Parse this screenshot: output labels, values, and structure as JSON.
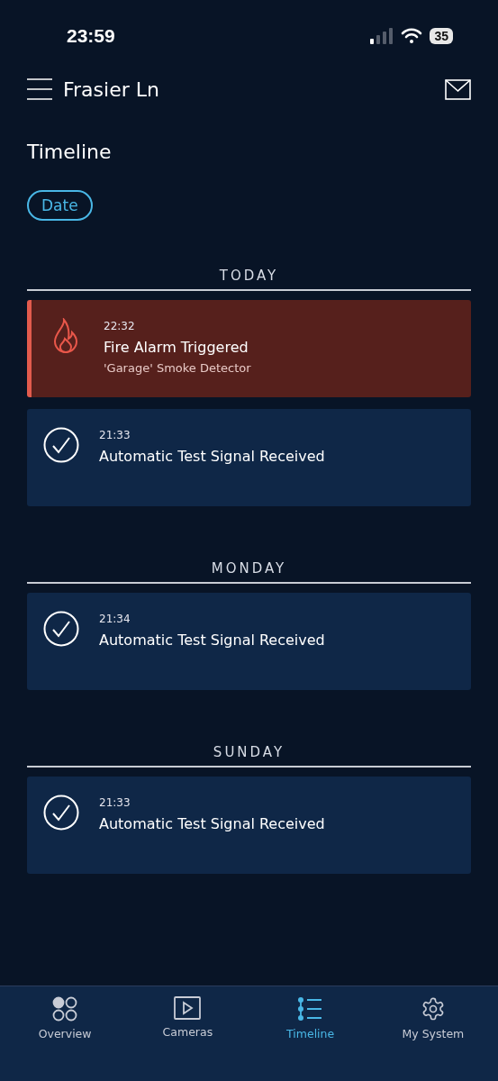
{
  "status_bar": {
    "time": "23:59",
    "battery": "35"
  },
  "header": {
    "title": "Frasier Ln"
  },
  "page_title": "Timeline",
  "filter": {
    "label": "Date"
  },
  "sections": [
    {
      "heading": "TODAY",
      "events": [
        {
          "kind": "alarm",
          "time": "22:32",
          "title": "Fire Alarm Triggered",
          "detail": "'Garage' Smoke Detector"
        },
        {
          "kind": "check",
          "time": "21:33",
          "title": "Automatic Test Signal Received"
        }
      ]
    },
    {
      "heading": "MONDAY",
      "events": [
        {
          "kind": "check",
          "time": "21:34",
          "title": "Automatic Test Signal Received"
        }
      ]
    },
    {
      "heading": "SUNDAY",
      "events": [
        {
          "kind": "check",
          "time": "21:33",
          "title": "Automatic Test Signal Received"
        }
      ]
    }
  ],
  "tab_bar": [
    {
      "kind": "overview",
      "label": "Overview",
      "selected": false
    },
    {
      "kind": "cameras",
      "label": "Cameras",
      "selected": false
    },
    {
      "kind": "timeline",
      "label": "Timeline",
      "selected": true
    },
    {
      "kind": "system",
      "label": "My System",
      "selected": false
    }
  ]
}
